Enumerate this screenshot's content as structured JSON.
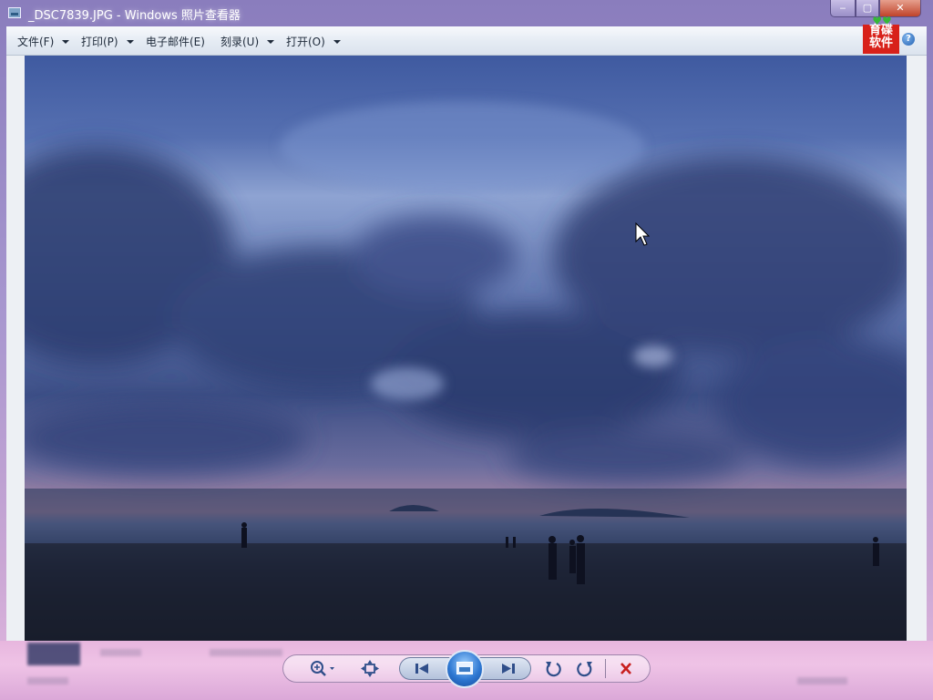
{
  "window": {
    "title": "_DSC7839.JPG - Windows 照片查看器",
    "minimize_label": "‒",
    "maximize_label": "▢",
    "close_label": "✕"
  },
  "menu": {
    "items": [
      {
        "label": "文件(F)"
      },
      {
        "label": "打印(P)"
      },
      {
        "label": "电子邮件(E)"
      },
      {
        "label": "刻录(U)"
      },
      {
        "label": "打开(O)"
      }
    ],
    "help_label": "?"
  },
  "logo": {
    "line1": "育碟",
    "line2": "软件",
    "color": "#d8211a"
  },
  "controls": {
    "zoom_icon": "magnifier-icon",
    "fit_icon": "fit-window-icon",
    "prev_icon": "previous-icon",
    "slideshow_icon": "slideshow-icon",
    "next_icon": "next-icon",
    "rotate_ccw_icon": "rotate-counterclockwise-icon",
    "rotate_cw_icon": "rotate-clockwise-icon",
    "delete_icon": "delete-icon",
    "delete_color": "#c81e1e"
  }
}
